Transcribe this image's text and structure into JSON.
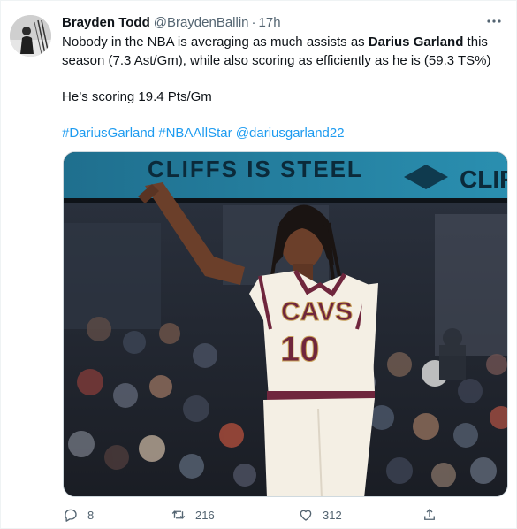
{
  "tweet": {
    "author_name": "Brayden Todd",
    "handle": "@BraydenBallin",
    "separator": "·",
    "time": "17h",
    "text_line1_a": "Nobody in the NBA is averaging as much assists as ",
    "text_line1_bold": "Darius Garland",
    "text_line1_b": " this season (7.3 Ast/Gm), while also scoring as efficiently as he is (59.3 TS%)",
    "text_line2": "He’s scoring 19.4 Pts/Gm",
    "tags": [
      "#DariusGarland",
      "#NBAAllStar",
      "@dariusgarland22"
    ]
  },
  "media": {
    "banner_text": "CLIFFS IS STEEL",
    "banner_text_right": "CLIF",
    "jersey_team": "CAVS",
    "jersey_number": "10"
  },
  "actions": {
    "replies": "8",
    "retweets": "216",
    "likes": "312"
  },
  "colors": {
    "accent": "#1d9bf0",
    "secondary_text": "#536471",
    "jersey_wine": "#6f263d",
    "jersey_gold": "#c8a15a"
  },
  "icons": [
    "more-icon",
    "reply-icon",
    "retweet-icon",
    "like-icon",
    "share-icon"
  ]
}
